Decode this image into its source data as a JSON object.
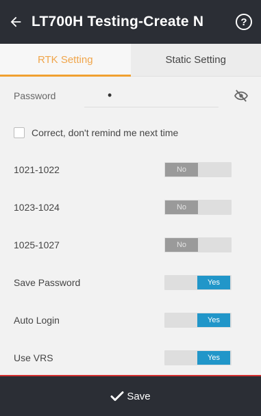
{
  "header": {
    "title": "LT700H Testing-Create N",
    "back_icon": "back-arrow-icon",
    "help_glyph": "?"
  },
  "tabs": [
    {
      "label": "RTK Setting",
      "active": true
    },
    {
      "label": "Static Setting",
      "active": false
    }
  ],
  "password": {
    "label": "Password",
    "value": "•"
  },
  "remember": {
    "label": "Correct, don't remind me next time",
    "checked": false
  },
  "toggles": [
    {
      "label": "1021-1022",
      "state_text": "No",
      "on": false
    },
    {
      "label": "1023-1024",
      "state_text": "No",
      "on": false
    },
    {
      "label": "1025-1027",
      "state_text": "No",
      "on": false
    },
    {
      "label": "Save Password",
      "state_text": "Yes",
      "on": true
    },
    {
      "label": "Auto Login",
      "state_text": "Yes",
      "on": true
    },
    {
      "label": "Use VRS",
      "state_text": "Yes",
      "on": true
    }
  ],
  "footer": {
    "save_label": "Save"
  },
  "colors": {
    "header_bg": "#2b2e35",
    "active_tab": "#f0a030",
    "toggle_on": "#2196c9",
    "toggle_off_knob": "#9a9a9a",
    "footer_accent": "#d32f2f"
  }
}
